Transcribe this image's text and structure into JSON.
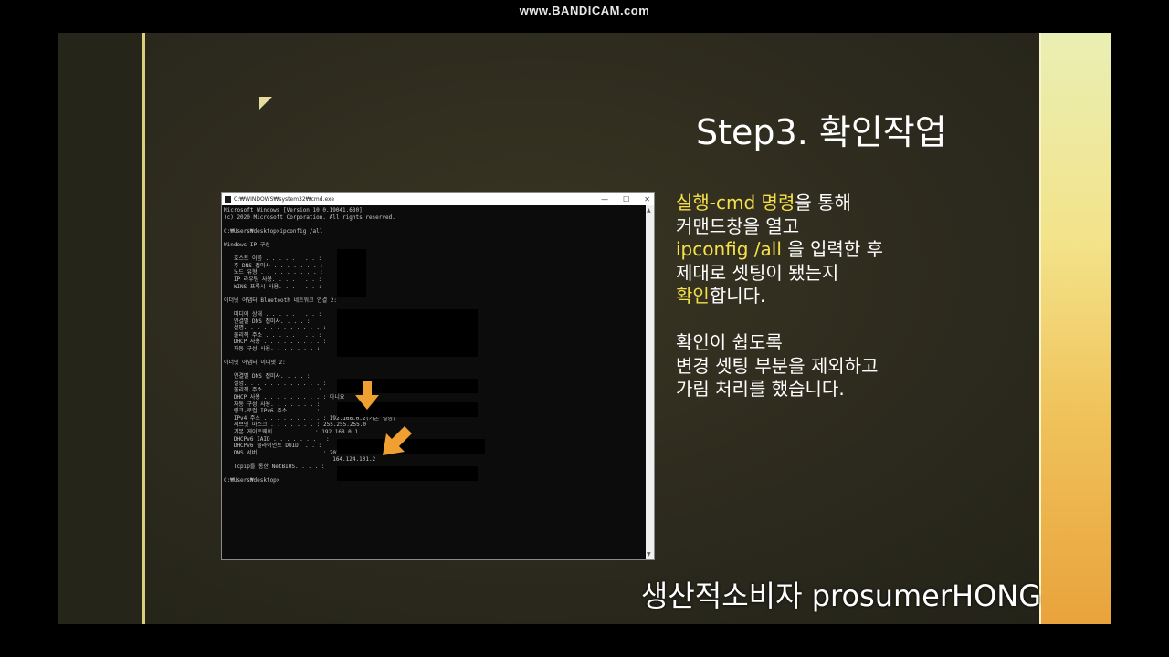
{
  "watermark": "www.BANDICAM.com",
  "slide": {
    "title": "Step3. 확인작업",
    "body": {
      "line1_hl": "실행-cmd 명령",
      "line1_rest": "을 통해",
      "line2": "커맨드창을 열고",
      "line3_hl": "ipconfig /all",
      "line3_rest": " 을 입력한 후",
      "line4": "제대로 셋팅이 됐는지",
      "line5_hl": "확인",
      "line5_rest": "합니다.",
      "line6": "확인이 쉽도록",
      "line7": "변경 셋팅 부분을 제외하고",
      "line8": "가림 처리를 했습니다."
    },
    "cmd": {
      "window_title": "C:₩WINDOWS₩system32₩cmd.exe",
      "minimize": "—",
      "maximize": "☐",
      "close": "✕",
      "lines": [
        "Microsoft Windows [Version 10.0.19041.630]",
        "(c) 2020 Microsoft Corporation. All rights reserved.",
        "",
        "C:₩Users₩desktop>ipconfig /all",
        "",
        "Windows IP 구성",
        "",
        "   호스트 이름 . . . . . . . . :",
        "   주 DNS 접미사 . . . . . . . :",
        "   노드 유형 . . . . . . . . . :",
        "   IP 라우팅 사용. . . . . . . :",
        "   WINS 프록시 사용. . . . . . :",
        "",
        "이더넷 어댑터 Bluetooth 네트워크 연결 2:",
        "",
        "   미디어 상태 . . . . . . . . :",
        "   연결별 DNS 접미사. . . . :",
        "   설명. . . . . . . . . . . . :",
        "   물리적 주소 . . . . . . . . :",
        "   DHCP 사용 . . . . . . . . . :",
        "   자동 구성 사용. . . . . . . :",
        "",
        "이더넷 어댑터 이더넷 2:",
        "",
        "   연결별 DNS 접미사. . . . :",
        "   설명. . . . . . . . . . . . :",
        "   물리적 주소 . . . . . . . . :",
        "   DHCP 사용 . . . . . . . . . : 아니요",
        "   자동 구성 사용. . . . . . . :",
        "   링크-로컬 IPv6 주소 . . . . :",
        "   IPv4 주소 . . . . . . . . . : 192.168.0.2(기본 설정)",
        "   서브넷 마스크 . . . . . . . : 255.255.255.0",
        "   기본 게이트웨이 . . . . . . : 192.168.0.1",
        "   DHCPv6 IAID . . . . . . . . :",
        "   DHCPv6 클라이언트 DUID. . . :",
        "   DNS 서버. . . . . . . . . . : 203.248.252.2",
        "                                 164.124.101.2",
        "   Tcpip를 통한 NetBIOS. . . . :",
        "",
        "C:₩Users₩desktop>"
      ]
    },
    "footer": "생산적소비자 prosumerHONG"
  },
  "colors": {
    "highlight": "#f4e04a",
    "arrow": "#f0a030"
  }
}
